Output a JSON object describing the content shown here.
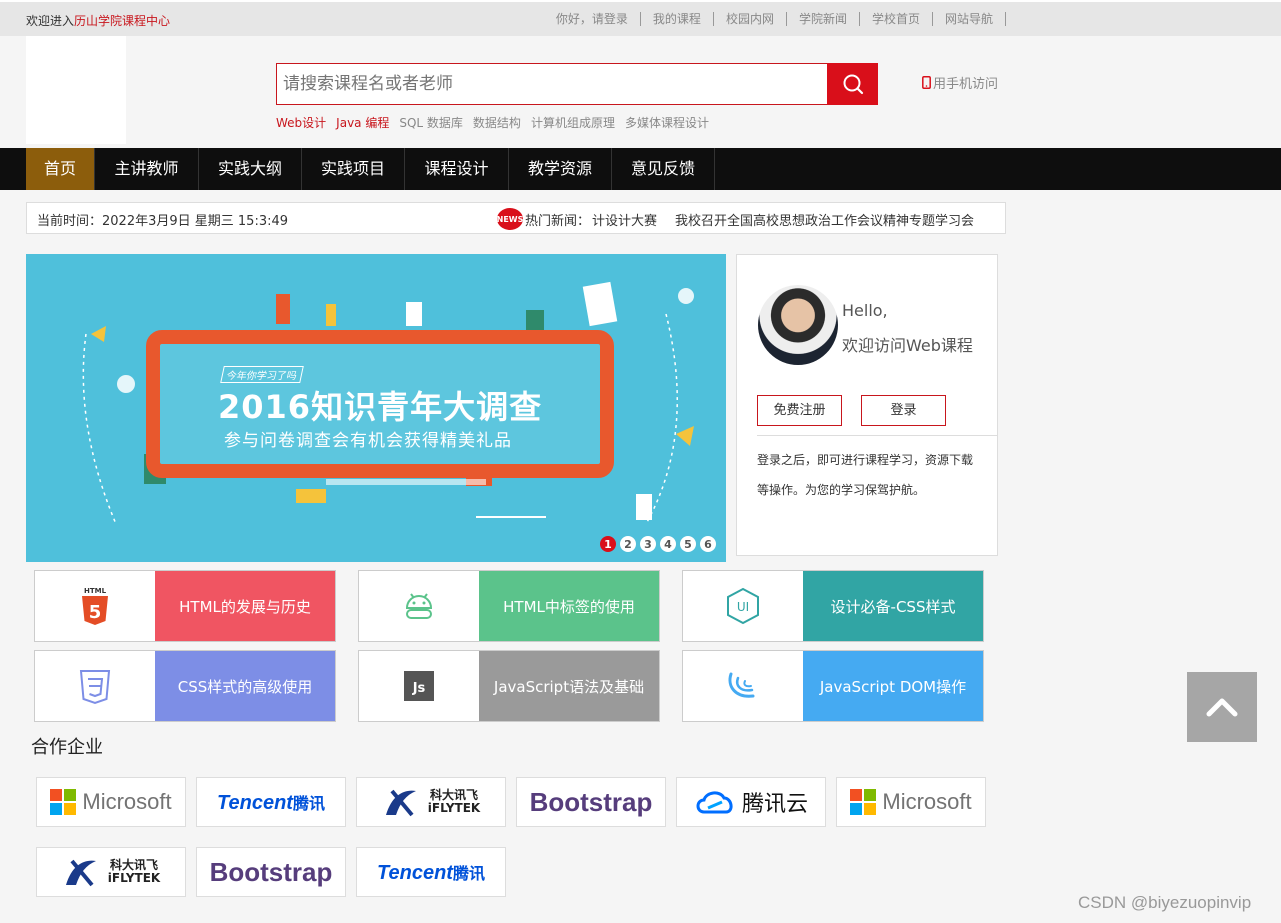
{
  "topbar": {
    "welcome_prefix": "欢迎进入",
    "welcome_site": "历山学院课程中心",
    "links": [
      "你好，请登录",
      "我的课程",
      "校园内网",
      "学院新闻",
      "学校首页",
      "网站导航"
    ]
  },
  "search": {
    "placeholder": "请搜索课程名或者老师",
    "hot_red": [
      "Web设计",
      "Java 编程"
    ],
    "hot_gray": [
      "SQL 数据库",
      "数据结构",
      "计算机组成原理",
      "多媒体课程设计"
    ]
  },
  "mobile_label": "用手机访问",
  "nav": {
    "items": [
      "首页",
      "主讲教师",
      "实践大纲",
      "实践项目",
      "课程设计",
      "教学资源",
      "意见反馈"
    ]
  },
  "infobar": {
    "time_label": "当前时间：",
    "time_value": "2022年3月9日 星期三 15:3:49",
    "news_badge": "NEWS",
    "news_label": "热门新闻：",
    "news_items": [
      "计设计大赛",
      "我校召开全国高校思想政治工作会议精神专题学习会"
    ]
  },
  "banner": {
    "tag": "今年你学习了吗",
    "headline": "2016知识青年大调查",
    "subline": "参与问卷调查会有机会获得精美礼品",
    "dots": [
      "1",
      "2",
      "3",
      "4",
      "5",
      "6"
    ],
    "active_dot": 1
  },
  "userbox": {
    "hello": "Hello,",
    "welcome": "欢迎访问Web课程",
    "register": "免费注册",
    "login": "登录",
    "desc": "登录之后，即可进行课程学习，资源下载等操作。为您的学习保驾护航。"
  },
  "courses": [
    {
      "label": "HTML的发展与历史",
      "color": "#f05562",
      "icon": "html5-icon"
    },
    {
      "label": "HTML中标签的使用",
      "color": "#5bc38b",
      "icon": "android-icon"
    },
    {
      "label": "设计必备-CSS样式",
      "color": "#31a5a4",
      "icon": "ui-icon"
    },
    {
      "label": "CSS样式的高级使用",
      "color": "#7d8ee6",
      "icon": "css3-icon"
    },
    {
      "label": "JavaScript语法及基础",
      "color": "#9a9a9a",
      "icon": "js-icon"
    },
    {
      "label": "JavaScript DOM操作",
      "color": "#45aaf2",
      "icon": "jquery-icon"
    }
  ],
  "partners_title": "合作企业",
  "partners": {
    "microsoft": "Microsoft",
    "tencent": "Tencent",
    "tencent_cn": "腾讯",
    "iflytek_cn": "科大讯飞",
    "iflytek_en": "iFLYTEK",
    "bootstrap": "Bootstrap",
    "tencent_cloud": "腾讯云"
  },
  "watermark": "CSDN @biyezuopinvip",
  "colors": {
    "brand_red": "#c8161d",
    "nav_active": "#8c5d0c",
    "nav_bg": "#0e0e0e"
  }
}
